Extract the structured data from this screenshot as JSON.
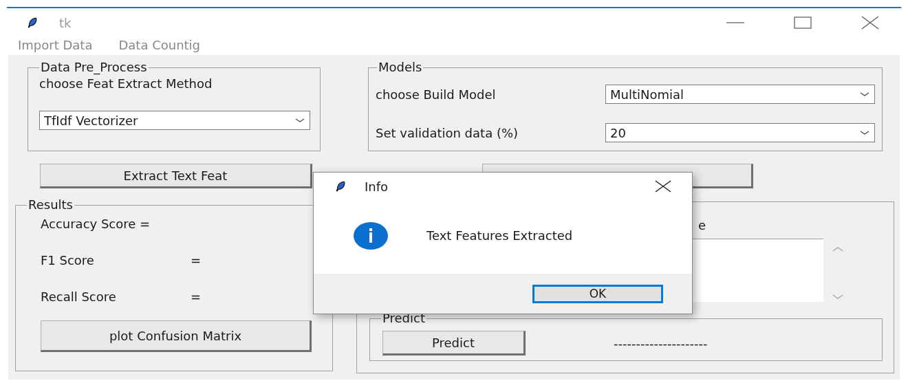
{
  "window": {
    "title": "tk"
  },
  "menu": [
    "Import Data",
    "Data Countig"
  ],
  "preprocess": {
    "title": "Data Pre_Process",
    "label": "choose Feat Extract Method",
    "select": "TfIdf Vectorizer"
  },
  "models": {
    "title": "Models",
    "rows": [
      {
        "label": "choose Build Model",
        "value": "MultiNomial"
      },
      {
        "label": "Set validation data (%)",
        "value": "20"
      }
    ]
  },
  "extract_button": "Extract Text Feat",
  "results": {
    "title": "Results",
    "rows": [
      {
        "label": "Accuracy Score =",
        "eq": ""
      },
      {
        "label": "F1 Score",
        "eq": "="
      },
      {
        "label": "Recall Score",
        "eq": "="
      }
    ],
    "button": "plot Confusion Matrix"
  },
  "output_panel": {
    "label_fragment": "e"
  },
  "predict": {
    "title": "Predict",
    "button": "Predict",
    "result": "---------------------"
  },
  "dialog": {
    "title": "Info",
    "message": "Text Features Extracted",
    "ok": "OK"
  }
}
